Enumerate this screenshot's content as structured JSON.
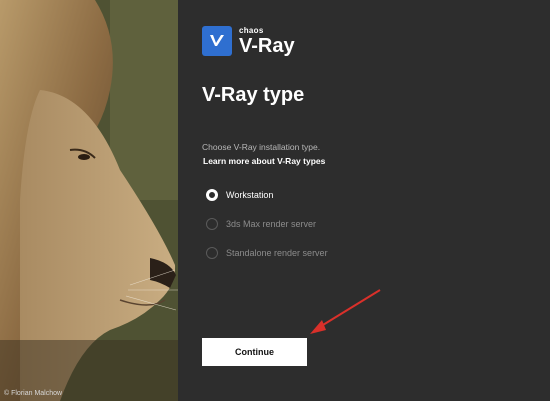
{
  "photo": {
    "credit": "© Florian Malchow"
  },
  "logo": {
    "brand": "chaos",
    "product": "V-Ray",
    "icon": "v-ray-logo-icon"
  },
  "page": {
    "title": "V-Ray type",
    "subtitle": "Choose V-Ray installation type.",
    "learn_more": "Learn more about V-Ray types"
  },
  "options": [
    {
      "label": "Workstation",
      "selected": true
    },
    {
      "label": "3ds Max render server",
      "selected": false
    },
    {
      "label": "Standalone render server",
      "selected": false
    }
  ],
  "actions": {
    "continue_label": "Continue"
  },
  "colors": {
    "panel_bg": "#2d2d2d",
    "accent": "#2f6fd0",
    "annotation_arrow": "#d9302a"
  }
}
